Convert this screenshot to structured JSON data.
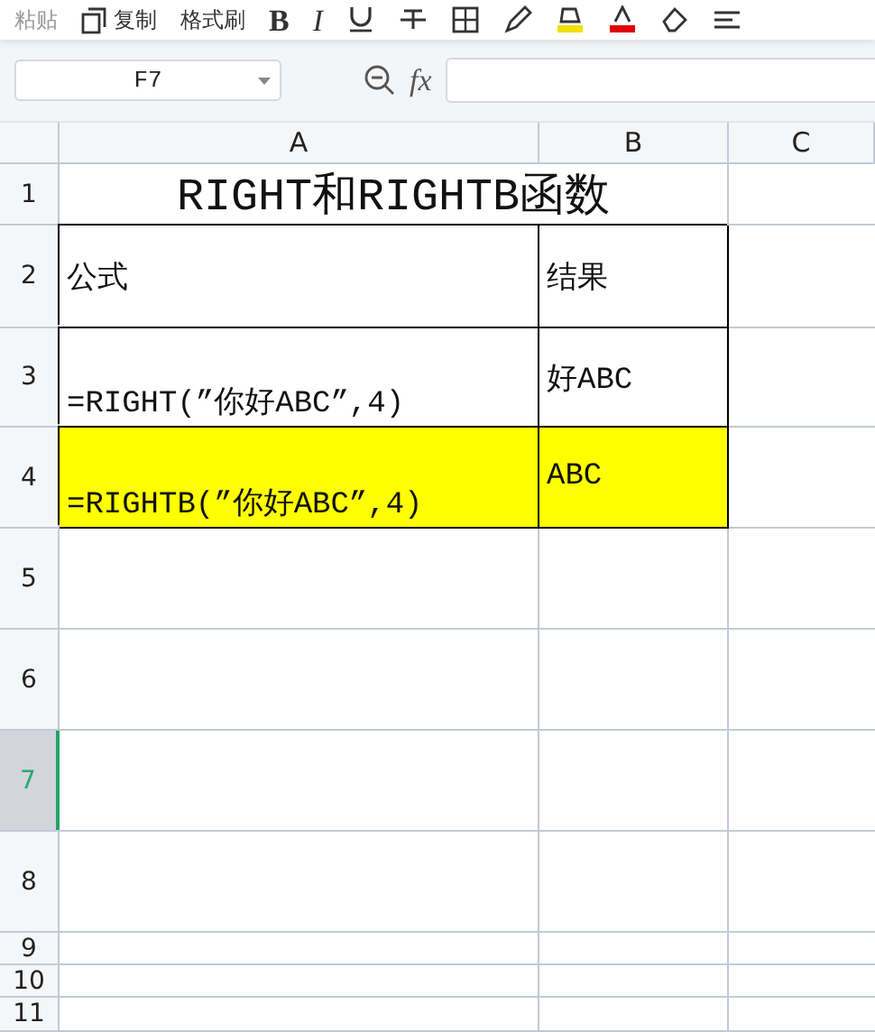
{
  "toolbar": {
    "items": [
      {
        "kind": "label",
        "label": "粘贴"
      },
      {
        "kind": "copy",
        "label": "复制"
      },
      {
        "kind": "label",
        "label": "格式刷"
      },
      {
        "kind": "bold",
        "label": "B"
      },
      {
        "kind": "italic",
        "label": "I"
      },
      {
        "kind": "underline"
      },
      {
        "kind": "strike"
      },
      {
        "kind": "border"
      },
      {
        "kind": "pen"
      },
      {
        "kind": "fill"
      },
      {
        "kind": "font-color"
      },
      {
        "kind": "eraser"
      },
      {
        "kind": "align"
      }
    ]
  },
  "name_box": {
    "value": "F7"
  },
  "formula_bar": {
    "function_label": "fx"
  },
  "columns": [
    {
      "label": "A",
      "selected": false
    },
    {
      "label": "B",
      "selected": false
    },
    {
      "label": "C",
      "selected": false
    }
  ],
  "rows": [
    {
      "header": "1",
      "selected": false,
      "cells": [
        {
          "kind": "title",
          "text": "RIGHT和RIGHTB函数"
        }
      ]
    },
    {
      "header": "2",
      "selected": false,
      "cells": [
        {
          "kind": "text",
          "text": "公式",
          "bordered": true,
          "highlighted": false
        },
        {
          "kind": "text",
          "text": "结果",
          "bordered": true,
          "highlighted": false
        }
      ]
    },
    {
      "header": "3",
      "selected": false,
      "cells": [
        {
          "kind": "formula",
          "text": "=RIGHT(”你好ABC”,4)",
          "bordered": true,
          "highlighted": false
        },
        {
          "kind": "text",
          "text": "好ABC",
          "bordered": true,
          "highlighted": false
        }
      ]
    },
    {
      "header": "4",
      "selected": false,
      "cells": [
        {
          "kind": "formula",
          "text": "=RIGHTB(”你好ABC”,4)",
          "bordered": true,
          "highlighted": true
        },
        {
          "kind": "text",
          "text": "ABC",
          "bordered": true,
          "highlighted": true
        }
      ]
    },
    {
      "header": "5",
      "selected": false,
      "cells": []
    },
    {
      "header": "6",
      "selected": false,
      "cells": []
    },
    {
      "header": "7",
      "selected": true,
      "cells": []
    },
    {
      "header": "8",
      "selected": false,
      "cells": []
    },
    {
      "header": "9",
      "selected": false,
      "cells": []
    },
    {
      "header": "10",
      "selected": false,
      "cells": []
    },
    {
      "header": "11",
      "selected": false,
      "cells": []
    }
  ]
}
